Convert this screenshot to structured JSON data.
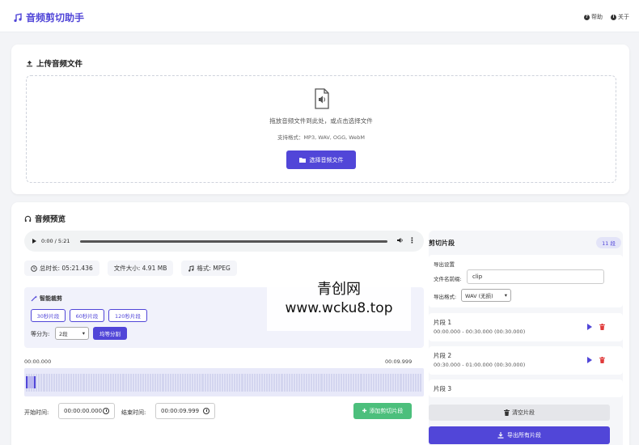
{
  "header": {
    "title": "音频剪切助手",
    "help": "帮助",
    "about": "关于"
  },
  "upload": {
    "title": "上传音频文件",
    "drop_text": "拖放音频文件到此处，或点击选择文件",
    "formats": "支持格式：MP3, WAV, OGG, WebM",
    "choose_button": "选择音频文件"
  },
  "preview": {
    "title": "音频预览",
    "player_time": "0:00 / 5:21",
    "duration": "总时长: 05:21.436",
    "filesize": "文件大小: 4.91 MB",
    "format": "格式: MPEG",
    "smart": {
      "title": "智能裁剪",
      "buttons": [
        "30秒片段",
        "60秒片段",
        "120秒片段"
      ],
      "divide_label": "等分为:",
      "divide_value": "2段",
      "even_button": "均等分割"
    },
    "wave_start": "00:00.000",
    "wave_end": "00:09.999",
    "start_label": "开始时间:",
    "start_value": "00:00:00.000",
    "end_label": "结束时间:",
    "end_value": "00:00:09.999",
    "add_button": "添加剪切片段"
  },
  "clips": {
    "title": "剪切片段",
    "count": "11 段",
    "export_settings": "导出设置",
    "filename_label": "文件名前缀:",
    "filename_value": "clip",
    "format_label": "导出格式:",
    "format_value": "WAV (无损)",
    "items": [
      {
        "name": "片段 1",
        "time": "00:00.000 - 00:30.000 (00:30.000)"
      },
      {
        "name": "片段 2",
        "time": "00:30.000 - 01:00.000 (00:30.000)"
      },
      {
        "name": "片段 3",
        "time": ""
      }
    ],
    "clear_button": "清空片段",
    "export_button": "导出所有片段"
  },
  "watermark": {
    "line1": "青创网",
    "line2": "www.wcku8.top"
  },
  "colors": {
    "accent": "#5146d8",
    "success": "#4cbf7c",
    "danger": "#e03b3b"
  }
}
